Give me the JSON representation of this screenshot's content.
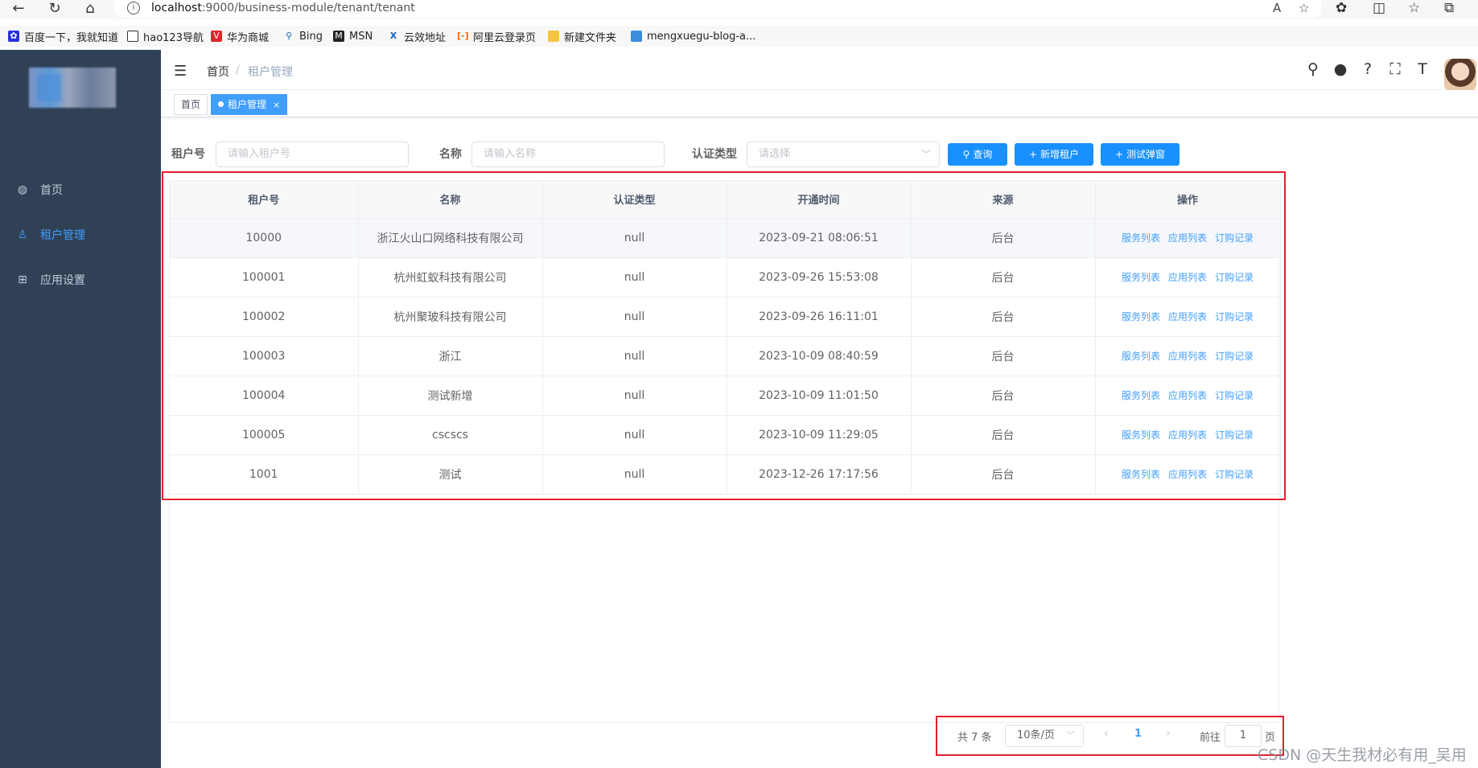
{
  "browser": {
    "url_host": "localhost",
    "url_rest": ":9000/business-module/tenant/tenant",
    "bookmarks": [
      "百度一下，我就知道",
      "hao123导航",
      "华为商城",
      "Bing",
      "MSN",
      "云效地址",
      "阿里云登录页",
      "新建文件夹",
      "mengxuegu-blog-a..."
    ]
  },
  "sidebar": {
    "items": [
      {
        "label": "首页",
        "icon": "dashboard-icon"
      },
      {
        "label": "租户管理",
        "icon": "user-icon"
      },
      {
        "label": "应用设置",
        "icon": "grid-icon"
      }
    ]
  },
  "navbar": {
    "breadcrumb_home": "首页",
    "breadcrumb_sep": "/",
    "breadcrumb_current": "租户管理"
  },
  "tags": {
    "home": "首页",
    "current": "租户管理",
    "close": "×"
  },
  "search": {
    "tenant_label": "租户号",
    "tenant_placeholder": "请输入租户号",
    "name_label": "名称",
    "name_placeholder": "请输入名称",
    "auth_label": "认证类型",
    "auth_placeholder": "请选择",
    "query_btn": "查询",
    "add_btn": "新增租户",
    "test_btn": "测试弹窗"
  },
  "table": {
    "headers": [
      "租户号",
      "名称",
      "认证类型",
      "开通时间",
      "来源",
      "操作"
    ],
    "ops": [
      "服务列表",
      "应用列表",
      "订购记录"
    ],
    "rows": [
      [
        "10000",
        "浙江火山口网络科技有限公司",
        "null",
        "2023-09-21 08:06:51",
        "后台"
      ],
      [
        "100001",
        "杭州虹蚁科技有限公司",
        "null",
        "2023-09-26 15:53:08",
        "后台"
      ],
      [
        "100002",
        "杭州聚玻科技有限公司",
        "null",
        "2023-09-26 16:11:01",
        "后台"
      ],
      [
        "100003",
        "浙江",
        "null",
        "2023-10-09 08:40:59",
        "后台"
      ],
      [
        "100004",
        "测试新增",
        "null",
        "2023-10-09 11:01:50",
        "后台"
      ],
      [
        "100005",
        "cscscs",
        "null",
        "2023-10-09 11:29:05",
        "后台"
      ],
      [
        "1001",
        "测试",
        "null",
        "2023-12-26 17:17:56",
        "后台"
      ]
    ]
  },
  "pagination": {
    "total": "共 7 条",
    "page_size": "10条/页",
    "current_page": "1",
    "goto_label": "前往",
    "goto_value": "1",
    "page_unit": "页"
  },
  "watermark": "CSDN @天生我材必有用_吴用",
  "colors": {
    "primary": "#409eff",
    "sidebar": "#304156",
    "highlight_box": "#e5202e"
  }
}
